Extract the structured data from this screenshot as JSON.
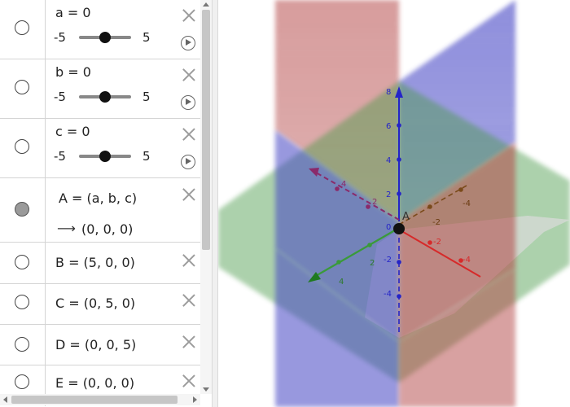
{
  "algebra": {
    "sliders": [
      {
        "name": "a",
        "definition": "a = 0",
        "min": "-5",
        "max": "5",
        "value": 0,
        "range": [
          -5,
          5
        ]
      },
      {
        "name": "b",
        "definition": "b = 0",
        "min": "-5",
        "max": "5",
        "value": 0,
        "range": [
          -5,
          5
        ]
      },
      {
        "name": "c",
        "definition": "c = 0",
        "min": "-5",
        "max": "5",
        "value": 0,
        "range": [
          -5,
          5
        ]
      }
    ],
    "point_A": {
      "definition": "A = (a, b, c)",
      "arrow": "⟶",
      "result": "(0, 0, 0)"
    },
    "points": [
      {
        "name": "B",
        "definition": "B = (5, 0, 0)"
      },
      {
        "name": "C",
        "definition": "C = (0, 5, 0)"
      },
      {
        "name": "D",
        "definition": "D = (0, 0, 5)"
      },
      {
        "name": "E",
        "definition": "E = (0, 0, 0)"
      }
    ]
  },
  "view3d": {
    "point_label": "A",
    "z_ticks": [
      "8",
      "6",
      "4",
      "2",
      "0",
      "-2",
      "-4"
    ],
    "x_ticks": [
      "4",
      "2",
      "-2",
      "-4"
    ],
    "y_ticks": [
      "4",
      "2",
      "-2",
      "-4"
    ],
    "colors": {
      "x_axis": "#d62a2a",
      "y_axis": "#3a9a3a",
      "z_axis": "#2424c8",
      "neg_x": "#8a2a6a",
      "neg_y": "#7a4a1a",
      "plane_red": "#b34444",
      "plane_blue": "#4444c4",
      "plane_green": "#4a9a4a"
    }
  }
}
